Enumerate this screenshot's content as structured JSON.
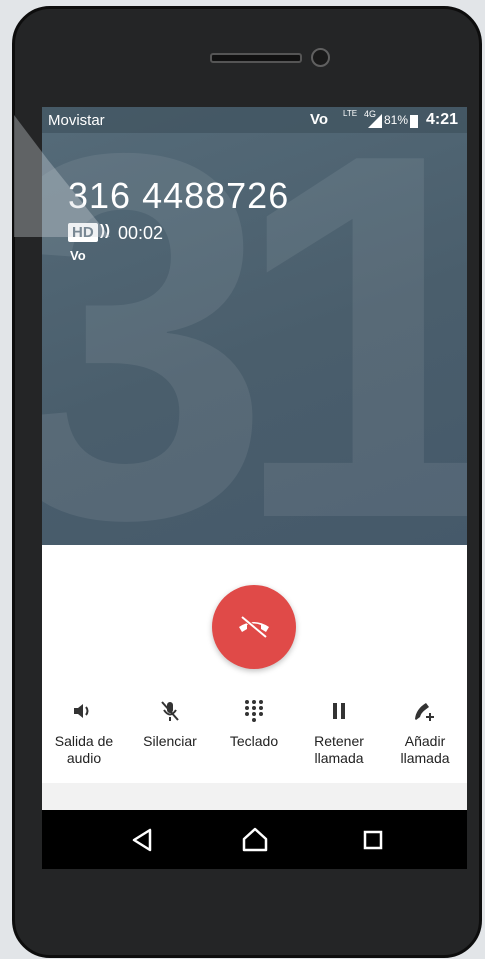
{
  "status_bar": {
    "carrier": "Movistar",
    "volte": "Vo",
    "lte": "LTE",
    "network": "4G",
    "battery": "81%",
    "time": "4:21"
  },
  "call": {
    "number": "316 4488726",
    "background_digits": "31",
    "hd_label": "HD",
    "duration": "00:02",
    "volte_badge": "Vo"
  },
  "actions": [
    {
      "label": "Salida de\naudio",
      "icon": "speaker-icon"
    },
    {
      "label": "Silenciar",
      "icon": "mic-off-icon"
    },
    {
      "label": "Teclado",
      "icon": "dialpad-icon"
    },
    {
      "label": "Retener\nllamada",
      "icon": "pause-icon"
    },
    {
      "label": "Añadir\nllamada",
      "icon": "add-call-icon"
    }
  ],
  "colors": {
    "hero": "#4b5f6d",
    "end_call": "#e04a48",
    "panel": "#ffffff",
    "navbar": "#000000"
  }
}
